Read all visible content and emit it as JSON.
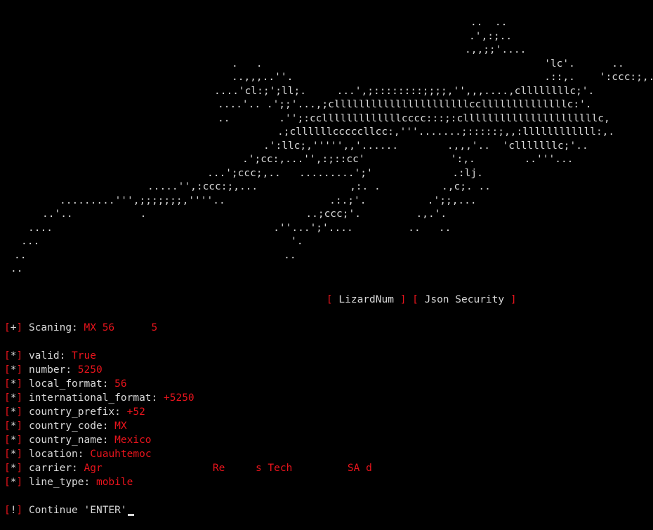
{
  "ascii_art": [
    {
      "indent": 670,
      "text": "..  .."
    },
    {
      "indent": 668,
      "text": ".',:;.."
    },
    {
      "indent": 662,
      "text": ".,,;;'...."
    },
    {
      "indent": 330,
      "text": ".   .                                              'lc'.      .."
    },
    {
      "indent": 330,
      "text": "..,,,..''.                                         .::,.    ':ccc:;,.."
    },
    {
      "indent": 305,
      "text": "....'cl:;';ll;.     ...',;::::::::;;;;,'',,,....,cllllllllc;'."
    },
    {
      "indent": 310,
      "text": "....'.. .';;'...,;cllllllllllllllllllllllccllllllllllllllc:'."
    },
    {
      "indent": 310,
      "text": "..        .'';:cclllllllllllllcccc:::;:cllllllllllllllllllllllc,"
    },
    {
      "indent": 395,
      "text": ".;cllllllcccccllcc:,'''.......;:::::;,,:llllllllllll:,."
    },
    {
      "indent": 375,
      "text": ".':llc;,''''',,'......        .,,,'..  'clllllllc;'.."
    },
    {
      "indent": 345,
      "text": ".';cc:,...'',:;::cc'              ':,.        ..'''..."
    },
    {
      "indent": 295,
      "text": "...';ccc;,..   .........';'             .:lj."
    },
    {
      "indent": 210,
      "text": ".....'',:ccc:;,...               ,:. .          .,c;. .."
    },
    {
      "indent": 85,
      "text": ".........''',;;;;;;;,''''..                 .:.;'.          .';;,..."
    },
    {
      "indent": 60,
      "text": "..'..           .                          ..;ccc;'.         .,.'."
    },
    {
      "indent": 40,
      "text": "....                                    .''...';'....         ..   .."
    },
    {
      "indent": 30,
      "text": "...                                         '."
    },
    {
      "indent": 20,
      "text": "..                                          .."
    },
    {
      "indent": 15,
      "text": ".."
    }
  ],
  "banner": {
    "lb1": "[",
    "name1": " LizardNum ",
    "rb1": "]",
    "lb2": "[",
    "name2": " Json Security ",
    "rb2": "]"
  },
  "scan": {
    "sym": "+",
    "label": "Scaning: ",
    "value": "MX 56      5"
  },
  "results": [
    {
      "key": "valid: ",
      "value": "True"
    },
    {
      "key": "number: ",
      "value": "5250"
    },
    {
      "key": "local_format: ",
      "value": "56"
    },
    {
      "key": "international_format: ",
      "value": "+5250"
    },
    {
      "key": "country_prefix: ",
      "value": "+52"
    },
    {
      "key": "country_code: ",
      "value": "MX"
    },
    {
      "key": "country_name: ",
      "value": "Mexico"
    },
    {
      "key": "location: ",
      "value": "Cuauhtemoc"
    },
    {
      "key": "carrier: ",
      "value": "Agr                  Re     s Tech         SA d"
    },
    {
      "key": "line_type: ",
      "value": "mobile"
    }
  ],
  "result_sym": "*",
  "prompt": {
    "sym": "!",
    "text": "Continue 'ENTER'"
  },
  "colors": {
    "background": "#000000",
    "foreground": "#d8d8d8",
    "accent_red": "#e8141c"
  }
}
